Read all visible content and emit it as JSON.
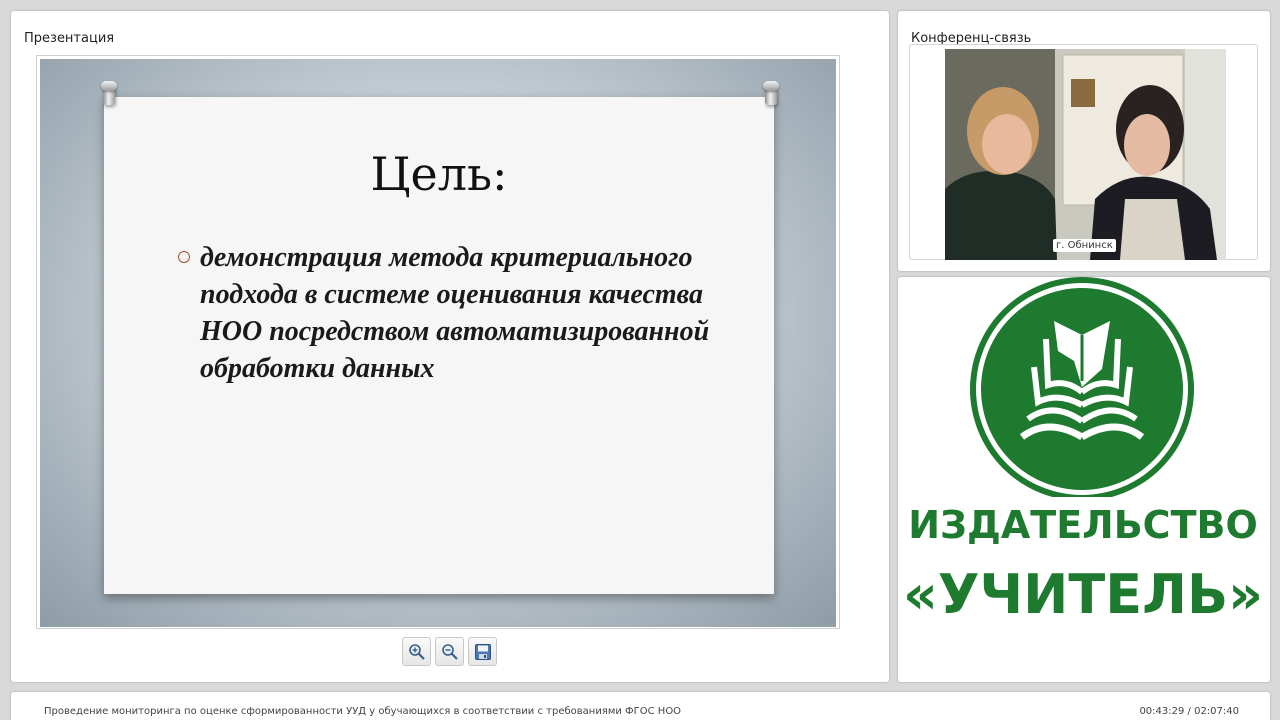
{
  "presentation": {
    "title": "Презентация",
    "slide": {
      "heading": "Цель:",
      "bullet": "демонстрация метода критериального подхода в системе оценивания качества НОО посредством автоматизированной обработки данных"
    },
    "tools": [
      {
        "name": "zoom-in",
        "icon": "zoom-in-icon"
      },
      {
        "name": "zoom-out",
        "icon": "zoom-out-icon"
      },
      {
        "name": "save",
        "icon": "floppy-disk-icon"
      }
    ]
  },
  "conference": {
    "title": "Конференц-связь",
    "video_label": "г. Обнинск"
  },
  "logo": {
    "line1": "ИЗДАТЕЛЬСТВО",
    "line2": "«УЧИТЕЛЬ»",
    "color": "#1e7a2e"
  },
  "footer": {
    "title": "Проведение мониторинга по оценке сформированности УУД  у обучающихся в соответствии с требованиями ФГОС НОО",
    "time": "00:43:29 / 02:07:40"
  }
}
